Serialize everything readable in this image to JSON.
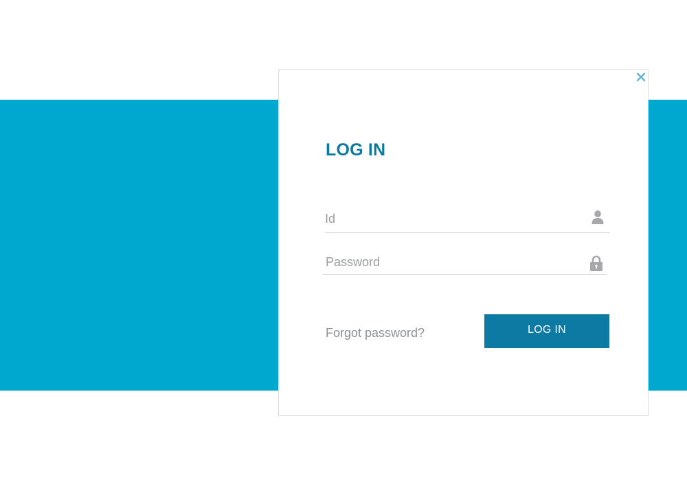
{
  "dialog": {
    "title": "LOG IN",
    "close_icon": "close-icon"
  },
  "form": {
    "id_field": {
      "value": "",
      "placeholder": "Id",
      "icon": "user-icon"
    },
    "password_field": {
      "value": "",
      "placeholder": "Password",
      "icon": "lock-icon"
    },
    "forgot_label": "Forgot password?",
    "submit_label": "LOG IN"
  },
  "colors": {
    "band": "#00a8cf",
    "accent": "#0c7aa0",
    "button": "#0d7aa3",
    "close": "#5db4d2",
    "icon": "#a5a8ab"
  }
}
